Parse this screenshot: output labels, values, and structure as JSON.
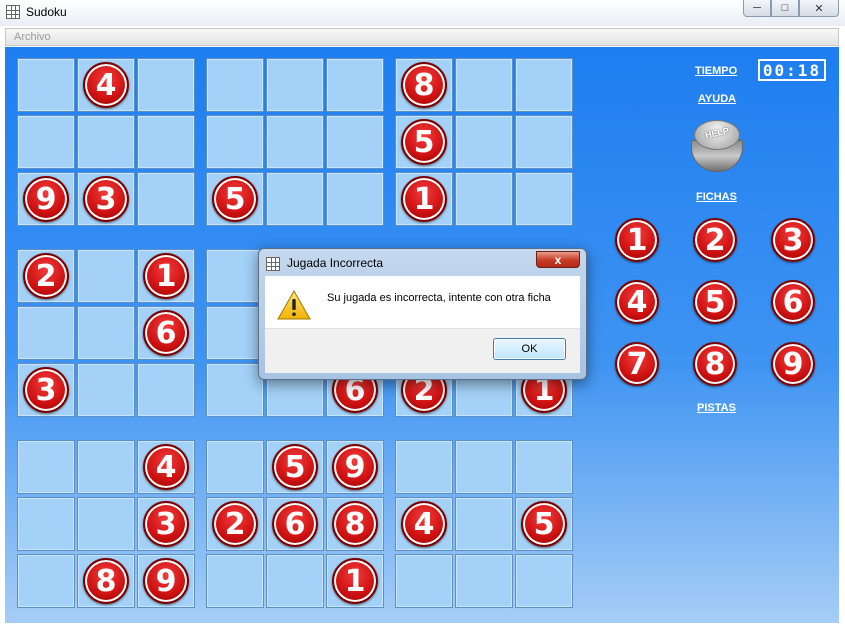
{
  "window": {
    "title": "Sudoku"
  },
  "menu": {
    "archivo": "Archivo"
  },
  "side": {
    "tiempo_label": "TIEMPO",
    "timer_value": "00:18",
    "ayuda_label": "AYUDA",
    "help_button_text": "HELP",
    "fichas_label": "FICHAS",
    "pistas_label": "PISTAS",
    "fichas": [
      "1",
      "2",
      "3",
      "4",
      "5",
      "6",
      "7",
      "8",
      "9"
    ]
  },
  "board": {
    "grid": [
      [
        "",
        "4",
        "",
        "",
        "",
        "",
        "8",
        "",
        ""
      ],
      [
        "",
        "",
        "",
        "",
        "",
        "",
        "5",
        "",
        ""
      ],
      [
        "9",
        "3",
        "",
        "5",
        "",
        "",
        "1",
        "",
        ""
      ],
      [
        "2",
        "",
        "1",
        "",
        "",
        "",
        "",
        "",
        ""
      ],
      [
        "",
        "",
        "6",
        "",
        "",
        "",
        "",
        "",
        ""
      ],
      [
        "3",
        "",
        "",
        "",
        "",
        "6",
        "2",
        "",
        "1"
      ],
      [
        "",
        "",
        "4",
        "",
        "5",
        "9",
        "",
        "",
        ""
      ],
      [
        "",
        "",
        "3",
        "2",
        "6",
        "8",
        "4",
        "",
        "5"
      ],
      [
        "",
        "8",
        "9",
        "",
        "",
        "1",
        "",
        "",
        ""
      ]
    ]
  },
  "dialog": {
    "title": "Jugada Incorrecta",
    "message": "Su jugada es incorrecta, intente con otra ficha",
    "ok_label": "OK",
    "close_label": "x"
  },
  "colors": {
    "background_top": "#1e7ef0",
    "cell": "#a3d1f7",
    "number_ball": "#d01212"
  }
}
